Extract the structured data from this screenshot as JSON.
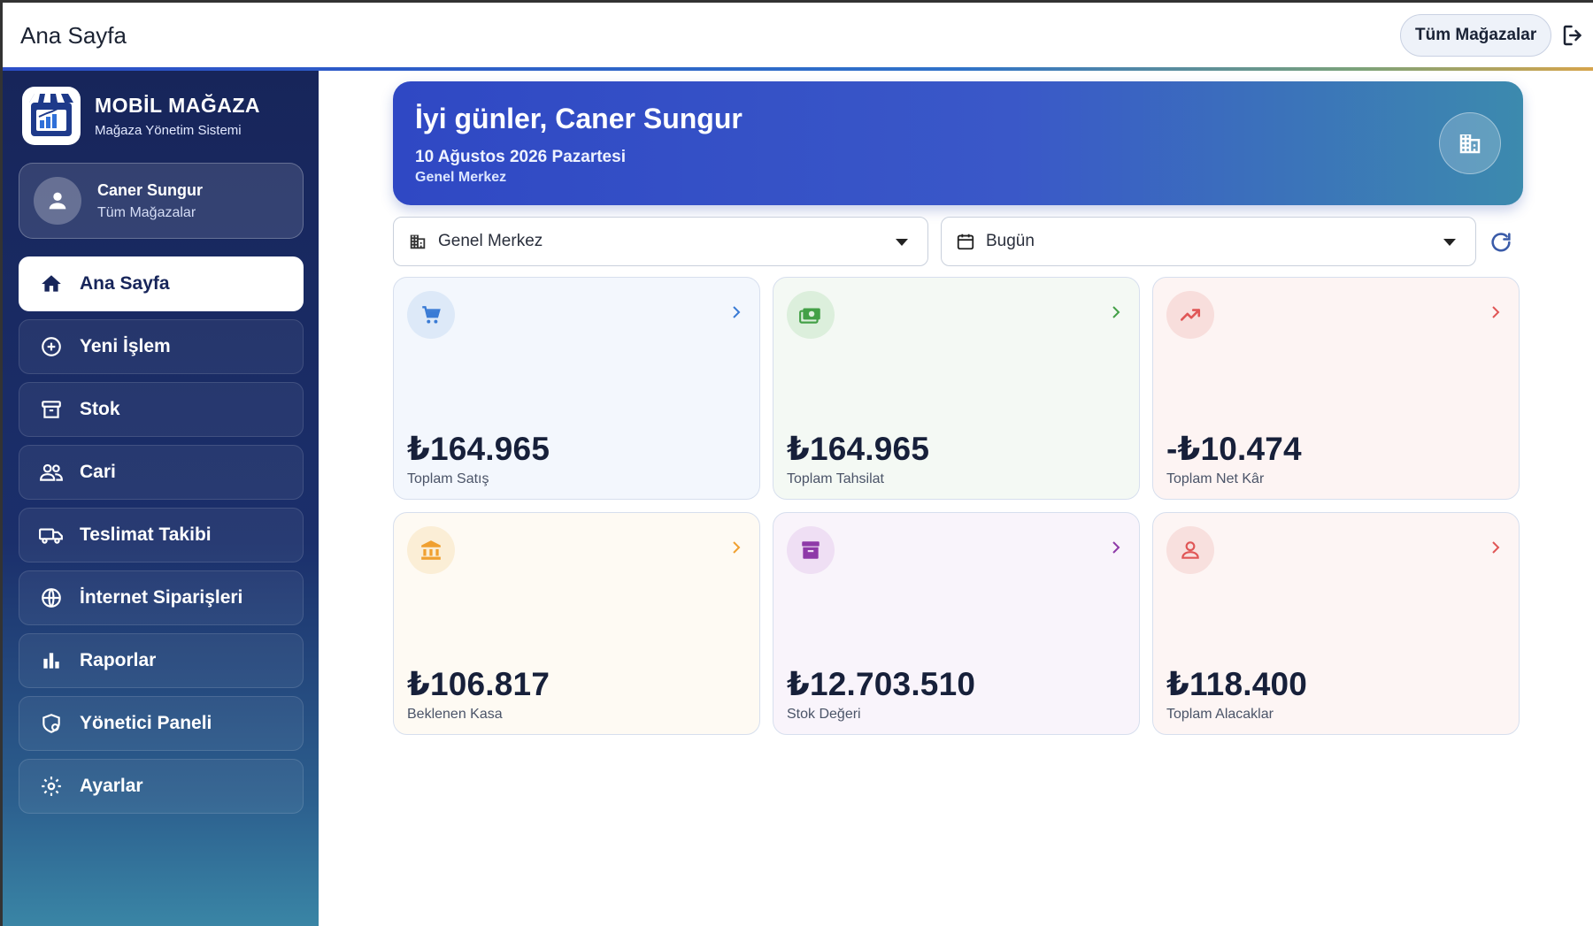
{
  "header": {
    "title": "Ana Sayfa",
    "store_button": "Tüm Mağazalar"
  },
  "sidebar": {
    "brand_name": "MOBİL MAĞAZA",
    "brand_subtitle": "Mağaza Yönetim Sistemi",
    "user": {
      "name": "Caner Sungur",
      "role": "Tüm Mağazalar"
    },
    "items": [
      {
        "label": "Ana Sayfa",
        "icon": "home-icon",
        "active": true
      },
      {
        "label": "Yeni İşlem",
        "icon": "plus-circle-icon"
      },
      {
        "label": "Stok",
        "icon": "archive-box-icon"
      },
      {
        "label": "Cari",
        "icon": "users-icon"
      },
      {
        "label": "Teslimat Takibi",
        "icon": "truck-icon"
      },
      {
        "label": "İnternet Siparişleri",
        "icon": "globe-icon"
      },
      {
        "label": "Raporlar",
        "icon": "bar-chart-icon"
      },
      {
        "label": "Yönetici Paneli",
        "icon": "admin-shield-icon"
      },
      {
        "label": "Ayarlar",
        "icon": "gear-icon"
      }
    ]
  },
  "banner": {
    "greeting": "İyi günler, Caner Sungur",
    "date": "10 Ağustos 2026 Pazartesi",
    "branch": "Genel Merkez"
  },
  "filters": {
    "store_select": "Genel Merkez",
    "period_select": "Bugün"
  },
  "cards": [
    {
      "value": "₺164.965",
      "label": "Toplam Satış",
      "icon": "cart-icon",
      "color": "#3a7bd5",
      "bg": "#f3f7fd",
      "icon_bg": "#dde9f8"
    },
    {
      "value": "₺164.965",
      "label": "Toplam Tahsilat",
      "icon": "cash-icon",
      "color": "#43a047",
      "bg": "#f4f9f4",
      "icon_bg": "#dcefdc"
    },
    {
      "value": "-₺10.474",
      "label": "Toplam Net Kâr",
      "icon": "trending-up-icon",
      "color": "#e05656",
      "bg": "#fdf4f3",
      "icon_bg": "#f8dedc"
    },
    {
      "value": "₺106.817",
      "label": "Beklenen Kasa",
      "icon": "bank-icon",
      "color": "#f0a030",
      "bg": "#fefaf3",
      "icon_bg": "#fbeed6"
    },
    {
      "value": "₺12.703.510",
      "label": "Stok Değeri",
      "icon": "archive-icon",
      "color": "#8e3aa8",
      "bg": "#f9f4fb",
      "icon_bg": "#efdff4"
    },
    {
      "value": "₺118.400",
      "label": "Toplam Alacaklar",
      "icon": "person-icon",
      "color": "#e05656",
      "bg": "#fdf5f4",
      "icon_bg": "#f8e0de"
    }
  ]
}
